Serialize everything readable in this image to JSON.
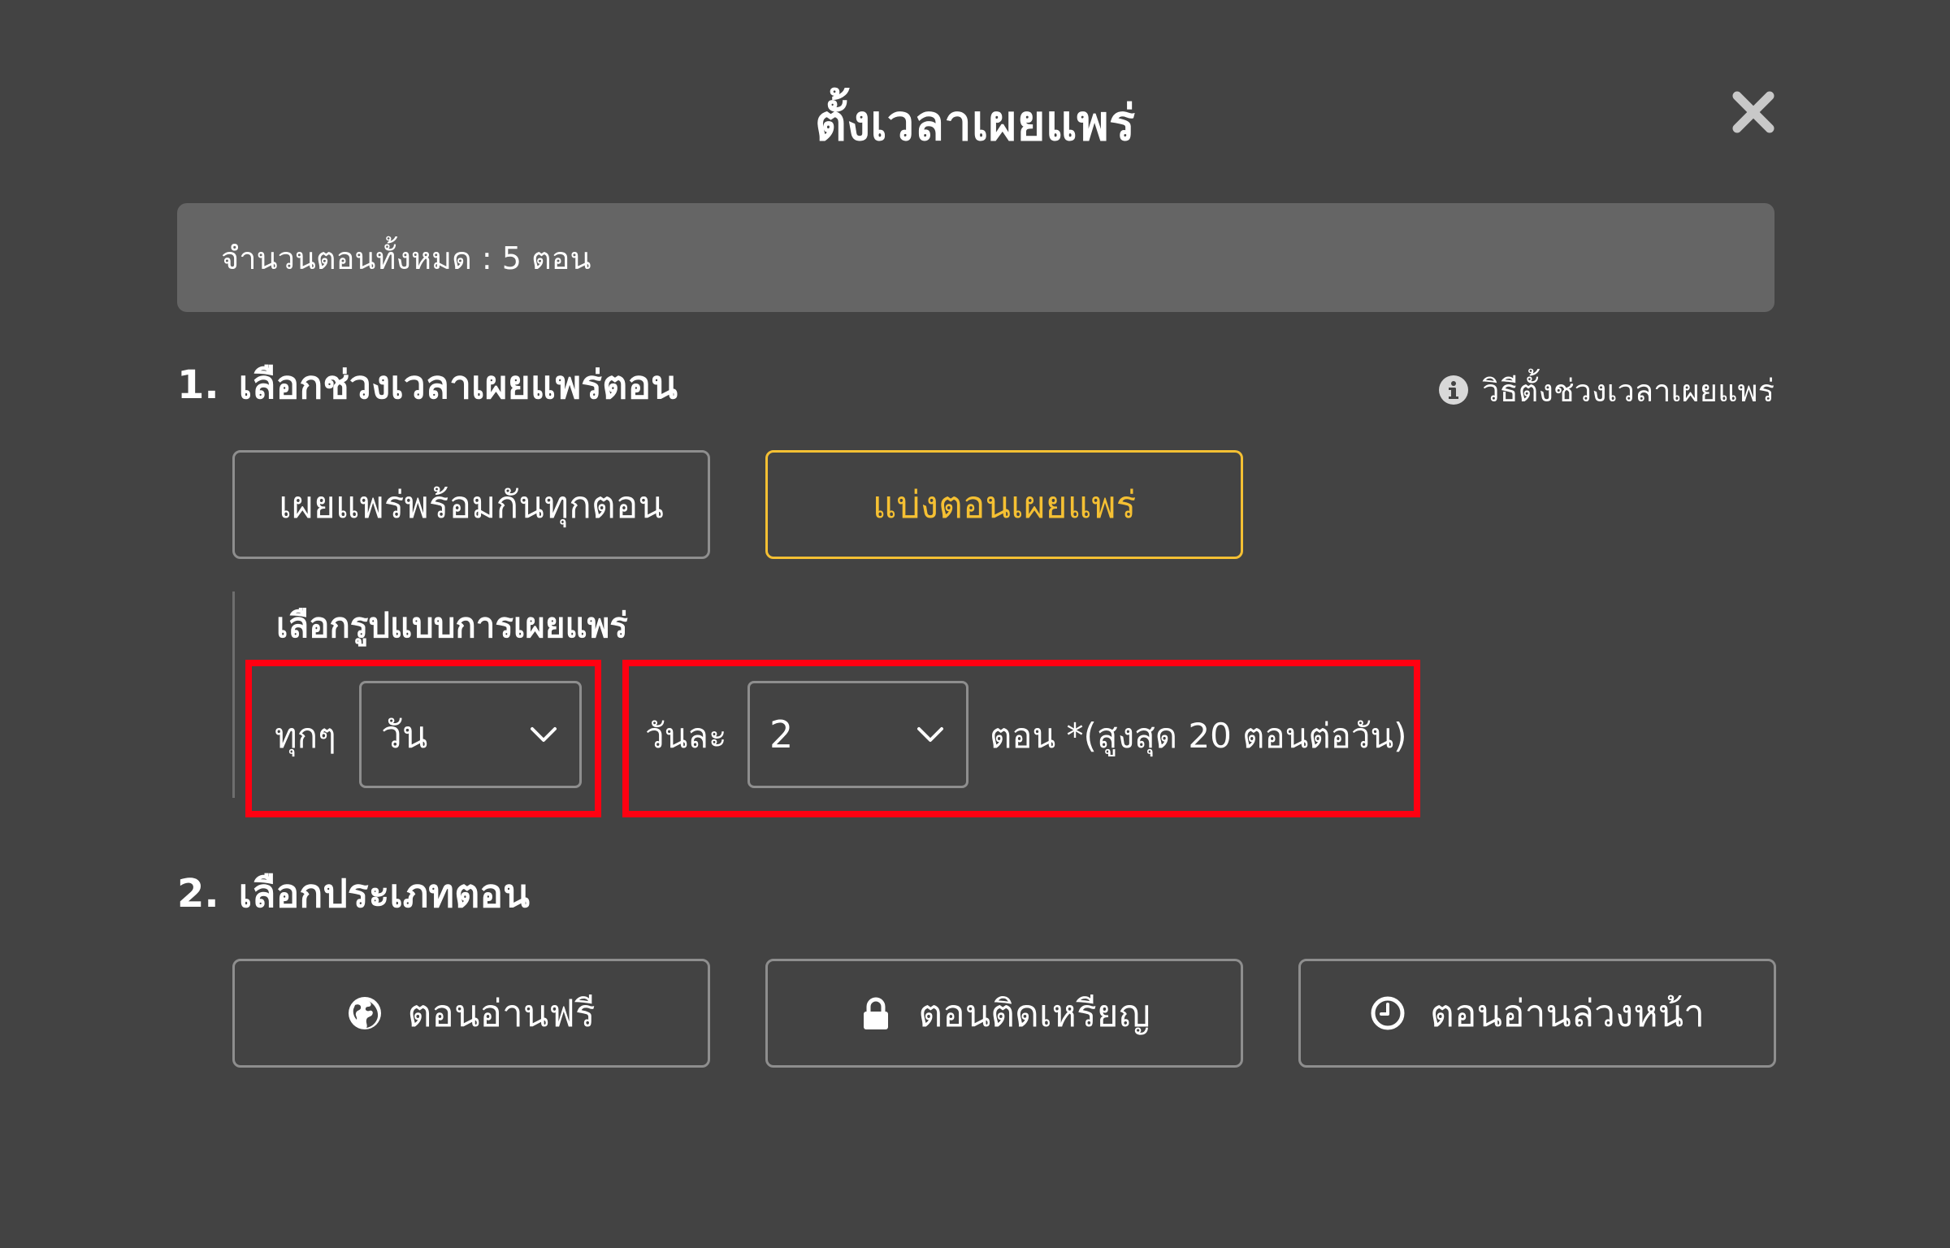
{
  "dialog": {
    "title": "ตั้งเวลาเผยแพร่",
    "close_icon": "close-icon"
  },
  "info_bar": {
    "text": "จำนวนตอนทั้งหมด : 5 ตอน"
  },
  "section1": {
    "number": "1.",
    "title": "เลือกช่วงเวลาเผยแพร่ตอน",
    "help_link": "วิธีตั้งช่วงเวลาเผยแพร่",
    "help_icon": "info-icon",
    "options": [
      {
        "label": "เผยแพร่พร้อมกันทุกตอน",
        "selected": false
      },
      {
        "label": "แบ่งตอนเผยแพร่",
        "selected": true
      }
    ],
    "sub": {
      "heading": "เลือกรูปแบบการเผยแพร่",
      "every_label": "ทุกๆ",
      "period_value": "วัน",
      "per_day_label": "วันละ",
      "count_value": "2",
      "note": "ตอน *(สูงสุด 20 ตอนต่อวัน)"
    }
  },
  "section2": {
    "number": "2.",
    "title": "เลือกประเภทตอน",
    "options": [
      {
        "label": "ตอนอ่านฟรี",
        "icon": "globe-icon"
      },
      {
        "label": "ตอนติดเหรียญ",
        "icon": "lock-icon"
      },
      {
        "label": "ตอนอ่านล่วงหน้า",
        "icon": "clock-icon"
      }
    ]
  },
  "colors": {
    "background": "#434343",
    "info_bar": "#656565",
    "accent": "#f5c033",
    "highlight": "#ff0011",
    "border": "#8e8e8e"
  }
}
